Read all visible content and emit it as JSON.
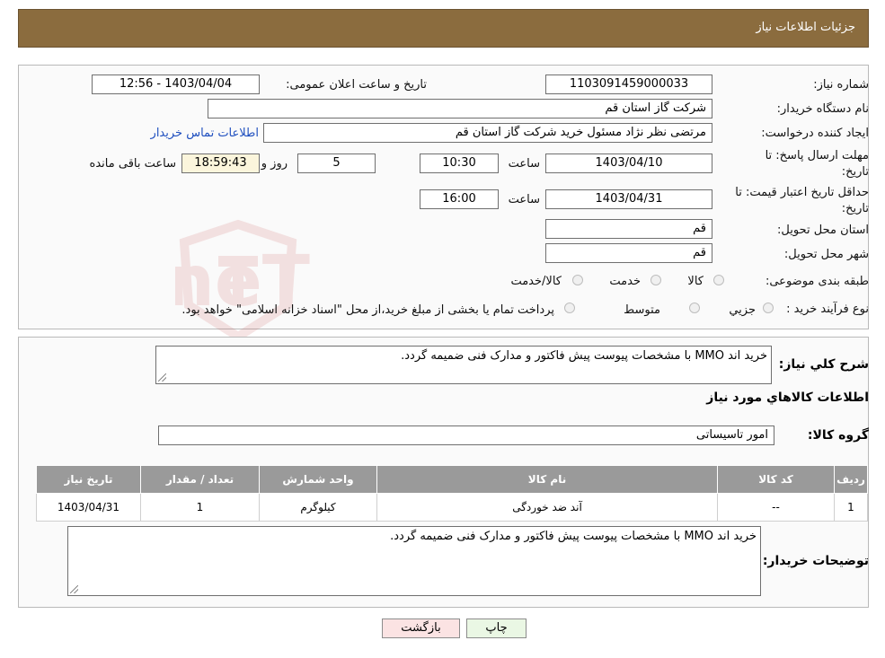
{
  "header": {
    "title": "جزئیات اطلاعات نیاز"
  },
  "form": {
    "need_number_label": "شماره نیاز:",
    "need_number": "1103091459000033",
    "announce_label": "تاریخ و ساعت اعلان عمومی:",
    "announce_value": "1403/04/04 - 12:56",
    "buyer_org_label": "نام دستگاه خریدار:",
    "buyer_org": "شرکت گاز استان قم",
    "creator_label": "ایجاد کننده درخواست:",
    "creator": "مرتضی نظر نژاد مسئول خرید شرکت گاز استان قم",
    "contact_link": "اطلاعات تماس خریدار",
    "deadline_label_1": "مهلت ارسال پاسخ: تا",
    "deadline_label_2": "تاریخ:",
    "deadline_date": "1403/04/10",
    "time_label": "ساعت",
    "deadline_time": "10:30",
    "days": "5",
    "days_label": "روز و",
    "remaining": "18:59:43",
    "remaining_label": "ساعت باقی مانده",
    "validity_label_1": "حداقل تاریخ اعتبار قیمت: تا",
    "validity_label_2": "تاریخ:",
    "validity_date": "1403/04/31",
    "validity_time": "16:00",
    "province_label": "استان محل تحویل:",
    "province": "قم",
    "city_label": "شهر محل تحویل:",
    "city": "قم",
    "category_label": "طبقه بندی موضوعی:",
    "category_options": [
      "کالا",
      "خدمت",
      "کالا/خدمت"
    ],
    "process_label": "نوع فرآیند خرید :",
    "process_options": [
      "جزیي",
      "متوسط"
    ],
    "process_note": "پرداخت تمام یا بخشی از مبلغ خرید،از محل \"اسناد خزانه اسلامی\" خواهد بود."
  },
  "details": {
    "summary_label": "شرح کلي نياز:",
    "summary": "خرید اند MMO   با مشخصات پیوست پیش فاکتور و مدارک فنی ضمیمه گردد.",
    "goods_info_title": "اطلاعات کالاهاي مورد نياز",
    "goods_group_label": "گروه کالا:",
    "goods_group": "امور تاسیساتی",
    "table": {
      "headers": [
        "رديف",
        "کد کالا",
        "نام کالا",
        "واحد شمارش",
        "تعداد / مقدار",
        "تاريخ نياز"
      ],
      "rows": [
        [
          "1",
          "--",
          "آند ضد خوردگی",
          "کیلوگرم",
          "1",
          "1403/04/31"
        ]
      ]
    },
    "buyer_notes_label": "توضيحات خريدار:",
    "buyer_notes": "خرید اند MMO   با مشخصات پیوست پیش فاکتور و مدارک فنی ضمیمه گردد."
  },
  "buttons": {
    "print": "چاپ",
    "back": "بازگشت"
  },
  "watermark": {
    "text": "AriaTender.neT"
  },
  "colors": {
    "header_bg": "#8b6c3e",
    "link": "#1f4fbf",
    "back_button_bg": "#fbe3e3",
    "print_button_bg": "#eaf7e4"
  }
}
